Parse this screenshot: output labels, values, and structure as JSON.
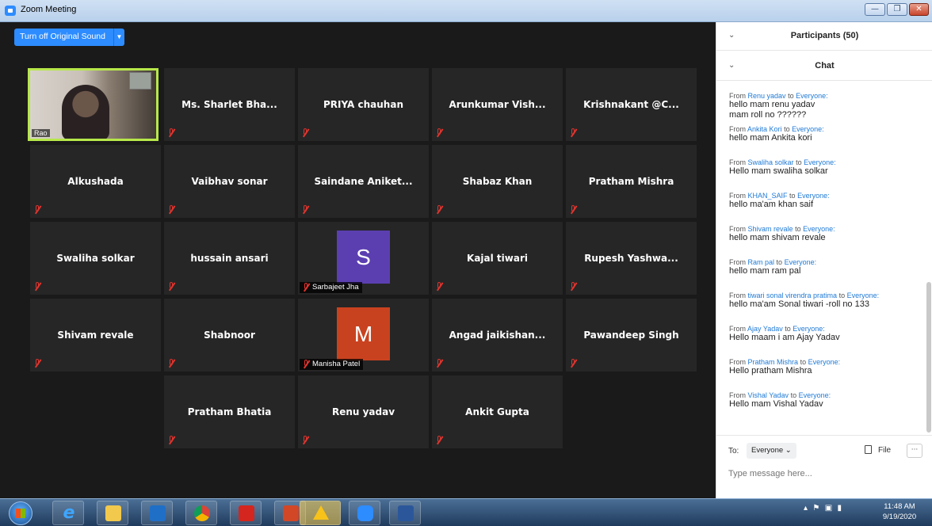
{
  "window": {
    "title": "Zoom Meeting"
  },
  "toolbar": {
    "sound_button": "Turn off Original Sound"
  },
  "video_tag": "Rao",
  "gallery": [
    {
      "name": "Ms. Sharlet Bha..."
    },
    {
      "name": "PRIYA chauhan"
    },
    {
      "name": "Arunkumar Vish..."
    },
    {
      "name": "Krishnakant @C..."
    },
    {
      "name": "Alkushada"
    },
    {
      "name": "Vaibhav sonar"
    },
    {
      "name": "Saindane Aniket..."
    },
    {
      "name": "Shabaz Khan"
    },
    {
      "name": "Pratham Mishra"
    },
    {
      "name": "Swaliha solkar"
    },
    {
      "name": "hussain ansari"
    },
    {
      "name": "Sarbajeet Jha",
      "initial": "S",
      "color": "#5b3fb1"
    },
    {
      "name": "Kajal tiwari"
    },
    {
      "name": "Rupesh Yashwa..."
    },
    {
      "name": "Shivam revale"
    },
    {
      "name": "Shabnoor"
    },
    {
      "name": "Manisha Patel",
      "initial": "M",
      "color": "#c9421f"
    },
    {
      "name": "Angad jaikishan..."
    },
    {
      "name": "Pawandeep Singh"
    },
    {
      "name": "Pratham Bhatia"
    },
    {
      "name": "Renu yadav"
    },
    {
      "name": "Ankit Gupta"
    }
  ],
  "participants_header": "Participants (50)",
  "chat_header": "Chat",
  "chat": [
    {
      "sender": "Renu yadav",
      "to_word": "to",
      "recipient": "Everyone:",
      "lines": [
        "hello mam renu yadav",
        "mam roll no ??????"
      ]
    },
    {
      "sender": "Ankita Kori",
      "to_word": "to",
      "recipient": "Everyone:",
      "lines": [
        "hello mam Ankita kori"
      ]
    },
    {
      "sender": "Swaliha solkar",
      "to_word": "to",
      "recipient": "Everyone:",
      "lines": [
        "Hello mam swaliha solkar"
      ]
    },
    {
      "sender": "KHAN_SAIF",
      "to_word": "to",
      "recipient": "Everyone:",
      "lines": [
        "hello ma'am khan saif"
      ]
    },
    {
      "sender": "Shivam revale",
      "to_word": "to",
      "recipient": "Everyone:",
      "lines": [
        "hello mam shivam revale"
      ]
    },
    {
      "sender": "Ram pal",
      "to_word": "to",
      "recipient": "Everyone:",
      "lines": [
        "hello mam ram pal"
      ]
    },
    {
      "sender": "tiwari sonal virendra pratima ",
      "to_word": "to",
      "recipient": "Everyone:",
      "lines": [
        "hello ma'am Sonal tiwari -roll no 133"
      ]
    },
    {
      "sender": "Ajay Yadav",
      "to_word": "to",
      "recipient": "Everyone:",
      "lines": [
        "Hello maam i am Ajay Yadav"
      ]
    },
    {
      "sender": "Pratham Mishra",
      "to_word": "to",
      "recipient": "Everyone:",
      "lines": [
        "Hello pratham Mishra"
      ]
    },
    {
      "sender": "Vishal Yadav",
      "to_word": "to",
      "recipient": "Everyone:",
      "lines": [
        "Hello mam Vishal Yadav"
      ]
    }
  ],
  "chat_from_word": "From",
  "compose": {
    "to_label": "To:",
    "recipient": "Everyone ⌄",
    "file_label": "File",
    "more": "···",
    "placeholder": "Type message here..."
  },
  "taskbar": {
    "time": "11:48 AM",
    "date": "9/19/2020",
    "icons": [
      "windows-start-icon",
      "ie-icon",
      "explorer-icon",
      "outlook-icon",
      "chrome-icon",
      "acrobat-icon",
      "powerpoint-icon",
      "warning-icon",
      "zoom-icon",
      "word-icon"
    ]
  }
}
